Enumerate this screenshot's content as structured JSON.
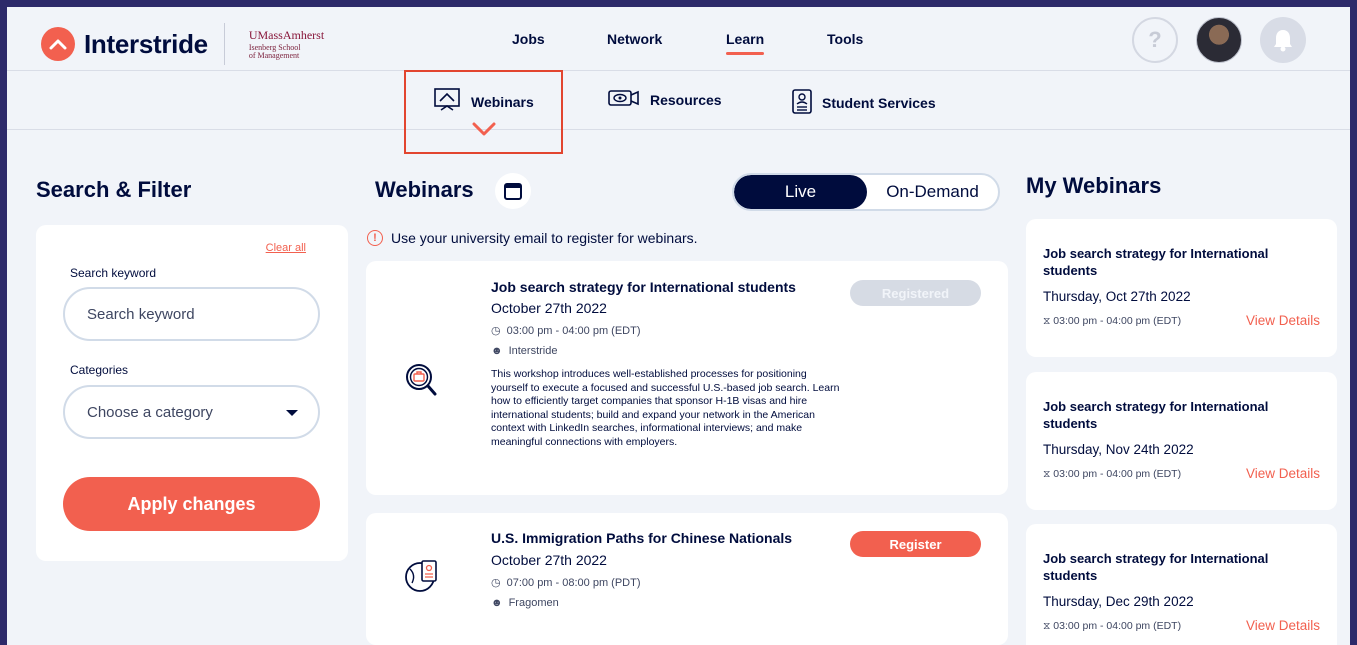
{
  "brand": {
    "name": "Interstride",
    "school_line1": "UMassAmherst",
    "school_line2": "Isenberg School",
    "school_line3": "of Management",
    "accent_color": "#f2604f",
    "navy_color": "#000c3d"
  },
  "nav": {
    "items": [
      "Jobs",
      "Network",
      "Learn",
      "Tools"
    ],
    "active": "Learn"
  },
  "topicons": {
    "help": "?",
    "help_icon": "question-circle-icon",
    "avatar_icon": "user-avatar",
    "bell_icon": "bell-icon"
  },
  "subnav": {
    "items": [
      {
        "label": "Webinars",
        "icon": "presentation-icon"
      },
      {
        "label": "Resources",
        "icon": "video-camera-icon"
      },
      {
        "label": "Student Services",
        "icon": "clipboard-user-icon"
      }
    ],
    "active": "Webinars"
  },
  "filter": {
    "heading": "Search & Filter",
    "clear_all": "Clear all",
    "keyword_label": "Search keyword",
    "keyword_placeholder": "Search keyword",
    "categories_label": "Categories",
    "category_value": "Choose a category",
    "apply_label": "Apply changes"
  },
  "webinars": {
    "heading": "Webinars",
    "toggle_live": "Live",
    "toggle_on_demand": "On-Demand",
    "notice": "Use your university email to register for webinars.",
    "cards": [
      {
        "title": "Job search strategy for International students",
        "date": "October 27th 2022",
        "time": "03:00 pm - 04:00 pm (EDT)",
        "host": "Interstride",
        "description": "This workshop introduces well-established processes for positioning yourself to execute a focused and successful U.S.-based job search. Learn how to efficiently target companies that sponsor H-1B visas and hire international students; build and expand your network in the American context with LinkedIn searches, informational interviews; and make meaningful connections with employers.",
        "button": "Registered",
        "icon": "magnifier-briefcase-icon"
      },
      {
        "title": "U.S. Immigration Paths for Chinese Nationals",
        "date": "October 27th 2022",
        "time": "07:00 pm - 08:00 pm (PDT)",
        "host": "Fragomen",
        "button": "Register",
        "icon": "globe-document-icon"
      }
    ]
  },
  "my_webinars": {
    "heading": "My Webinars",
    "cards": [
      {
        "title": "Job search strategy for International students",
        "date": "Thursday, Oct 27th 2022",
        "time": "⧖ 03:00 pm - 04:00 pm (EDT)",
        "link": "View Details"
      },
      {
        "title": "Job search strategy for International students",
        "date": "Thursday, Nov 24th 2022",
        "time": "⧖ 03:00 pm - 04:00 pm (EDT)",
        "link": "View Details"
      },
      {
        "title": "Job search strategy for International students",
        "date": "Thursday, Dec 29th 2022",
        "time": "⧖ 03:00 pm - 04:00 pm (EDT)",
        "link": "View Details"
      }
    ]
  }
}
